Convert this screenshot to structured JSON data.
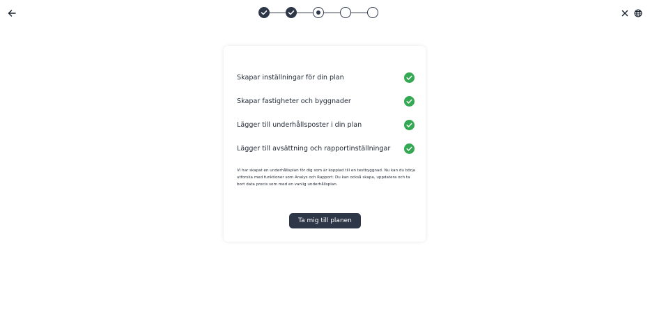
{
  "header": {
    "back_icon": "arrow-left-icon",
    "close_icon": "close-icon",
    "language_icon": "globe-icon"
  },
  "stepper": {
    "total_steps": 5,
    "current_step": 3,
    "steps": [
      {
        "state": "done"
      },
      {
        "state": "done"
      },
      {
        "state": "current"
      },
      {
        "state": "todo"
      },
      {
        "state": "todo"
      }
    ]
  },
  "card": {
    "tasks": [
      {
        "label": "Skapar inställningar för din plan",
        "status": "done"
      },
      {
        "label": "Skapar fastigheter och byggnader",
        "status": "done"
      },
      {
        "label": "Lägger till underhållsposter i din plan",
        "status": "done"
      },
      {
        "label": "Lägger till avsättning och rapportinställningar",
        "status": "done"
      }
    ],
    "description": "Vi har skapat en underhållsplan för dig som är kopplad till en testbyggnad. Nu kan du börja utforska med funktioner som Analys och Rapport. Du kan också skapa, uppdatera och ta bort data precis som med en vanlig underhållsplan.",
    "cta_label": "Ta mig till planen"
  },
  "colors": {
    "primary": "#2d3748",
    "success": "#34a853",
    "background": "#ffffff"
  }
}
